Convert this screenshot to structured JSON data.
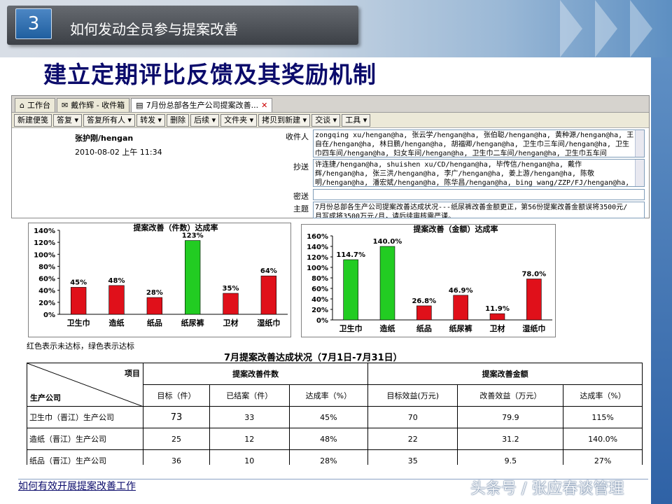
{
  "slide": {
    "section_number": "3",
    "section_title": "如何发动全员参与提案改善",
    "title": "建立定期评比反馈及其奖励机制",
    "footer_left": "如何有效开展提案改善工作",
    "footer_right": "头条号 / 张应春谈管理"
  },
  "mail_window": {
    "tabs": [
      {
        "icon": "home-icon",
        "label": "工作台"
      },
      {
        "icon": "mail-icon",
        "label": "戴作辉 - 收件箱"
      },
      {
        "icon": "document-icon",
        "label": "7月份总部各生产公司提案改善...",
        "closable": true
      }
    ],
    "toolbar": [
      "新建便笺",
      "答复 ▾",
      "答复所有人 ▾",
      "转发 ▾",
      "删除",
      "后续 ▾",
      "文件夹 ▾",
      "拷贝到新建 ▾",
      "交谈 ▾",
      "工具 ▾"
    ],
    "sender": "张护刚/hengan",
    "date": "2010-08-02 上午 11:34",
    "labels": {
      "to": "收件人",
      "cc": "抄送",
      "bcc": "密送",
      "subject": "主题"
    },
    "to": "zongqing xu/hengan@ha, 张云学/hengan@ha, 张伯聪/hengan@ha, 黄种源/hengan@ha, 王自在/hengan@ha, 林日鹏/hengan@ha, 胡福卿/hengan@ha, 卫生巾三车间/hengan@ha, 卫生巾四车间/hengan@ha, 妇女车间/hengan@ha, 卫生巾二车间/hengan@ha, 卫生巾五车间",
    "cc": "许连捷/hengan@ha, shuishen xu/CD/hengan@ha, 毕传信/hengan@ha, 戴作辉/hengan@ha, 张三洪/hengan@ha, 李广/hengan@ha, 姜上游/hengan@ha, 陈敬明/hengan@ha, 潘宏斌/hengan@ha, 陈华昌/hengan@ha, bing wang/ZZP/FJ/hengan@ha,",
    "bcc": "",
    "subject": "7月份总部各生产公司提案改善达成状况---纸尿裤改善金额更正，第56份提案改善金额误将3500元/月写成将3500万元/月，请后续审核需严谨。"
  },
  "chart_data": [
    {
      "type": "bar",
      "title": "提案改善（件数）达成率",
      "categories": [
        "卫生巾",
        "造纸",
        "纸品",
        "纸尿裤",
        "卫材",
        "湿纸巾"
      ],
      "values": [
        45,
        48,
        28,
        123,
        35,
        64
      ],
      "value_labels": [
        "45%",
        "48%",
        "28%",
        "123%",
        "35%",
        "64%"
      ],
      "colors": [
        "#e0101a",
        "#e0101a",
        "#e0101a",
        "#22cc22",
        "#e0101a",
        "#e0101a"
      ],
      "ytick_labels": [
        "0%",
        "20%",
        "40%",
        "60%",
        "80%",
        "100%",
        "120%",
        "140%"
      ],
      "ylim": [
        0,
        140
      ]
    },
    {
      "type": "bar",
      "title": "提案改善（金额）达成率",
      "categories": [
        "卫生巾",
        "造纸",
        "纸品",
        "纸尿裤",
        "卫材",
        "湿纸巾"
      ],
      "values": [
        114.7,
        140.0,
        26.8,
        46.9,
        11.9,
        78.0
      ],
      "value_labels": [
        "114.7%",
        "140.0%",
        "26.8%",
        "46.9%",
        "11.9%",
        "78.0%"
      ],
      "colors": [
        "#22cc22",
        "#22cc22",
        "#e0101a",
        "#e0101a",
        "#e0101a",
        "#e0101a"
      ],
      "ytick_labels": [
        "0%",
        "20%",
        "40%",
        "60%",
        "80%",
        "100%",
        "120%",
        "140%",
        "160%"
      ],
      "ylim": [
        0,
        160
      ]
    }
  ],
  "legend_note": "红色表示未达标，绿色表示达标",
  "table": {
    "title": "7月提案改善达成状况（7月1日-7月31日）",
    "corner_top": "项目",
    "corner_bottom": "生产公司",
    "group_headers": [
      "提案改善件数",
      "提案改善金额"
    ],
    "sub_headers": [
      "目标（件）",
      "已结案（件）",
      "达成率（%）",
      "目标效益(万元)",
      "改善效益（万元）",
      "达成率（%）"
    ],
    "rows": [
      {
        "company": "卫生巾（晋江）生产公司",
        "cells": [
          "73",
          "33",
          "45%",
          "70",
          "79.9",
          "115%"
        ]
      },
      {
        "company": "造纸（晋江）生产公司",
        "cells": [
          "25",
          "12",
          "48%",
          "22",
          "31.2",
          "140.0%"
        ]
      },
      {
        "company": "纸品（晋江）生产公司",
        "cells": [
          "36",
          "10",
          "28%",
          "35",
          "9.5",
          "27%"
        ]
      }
    ]
  }
}
